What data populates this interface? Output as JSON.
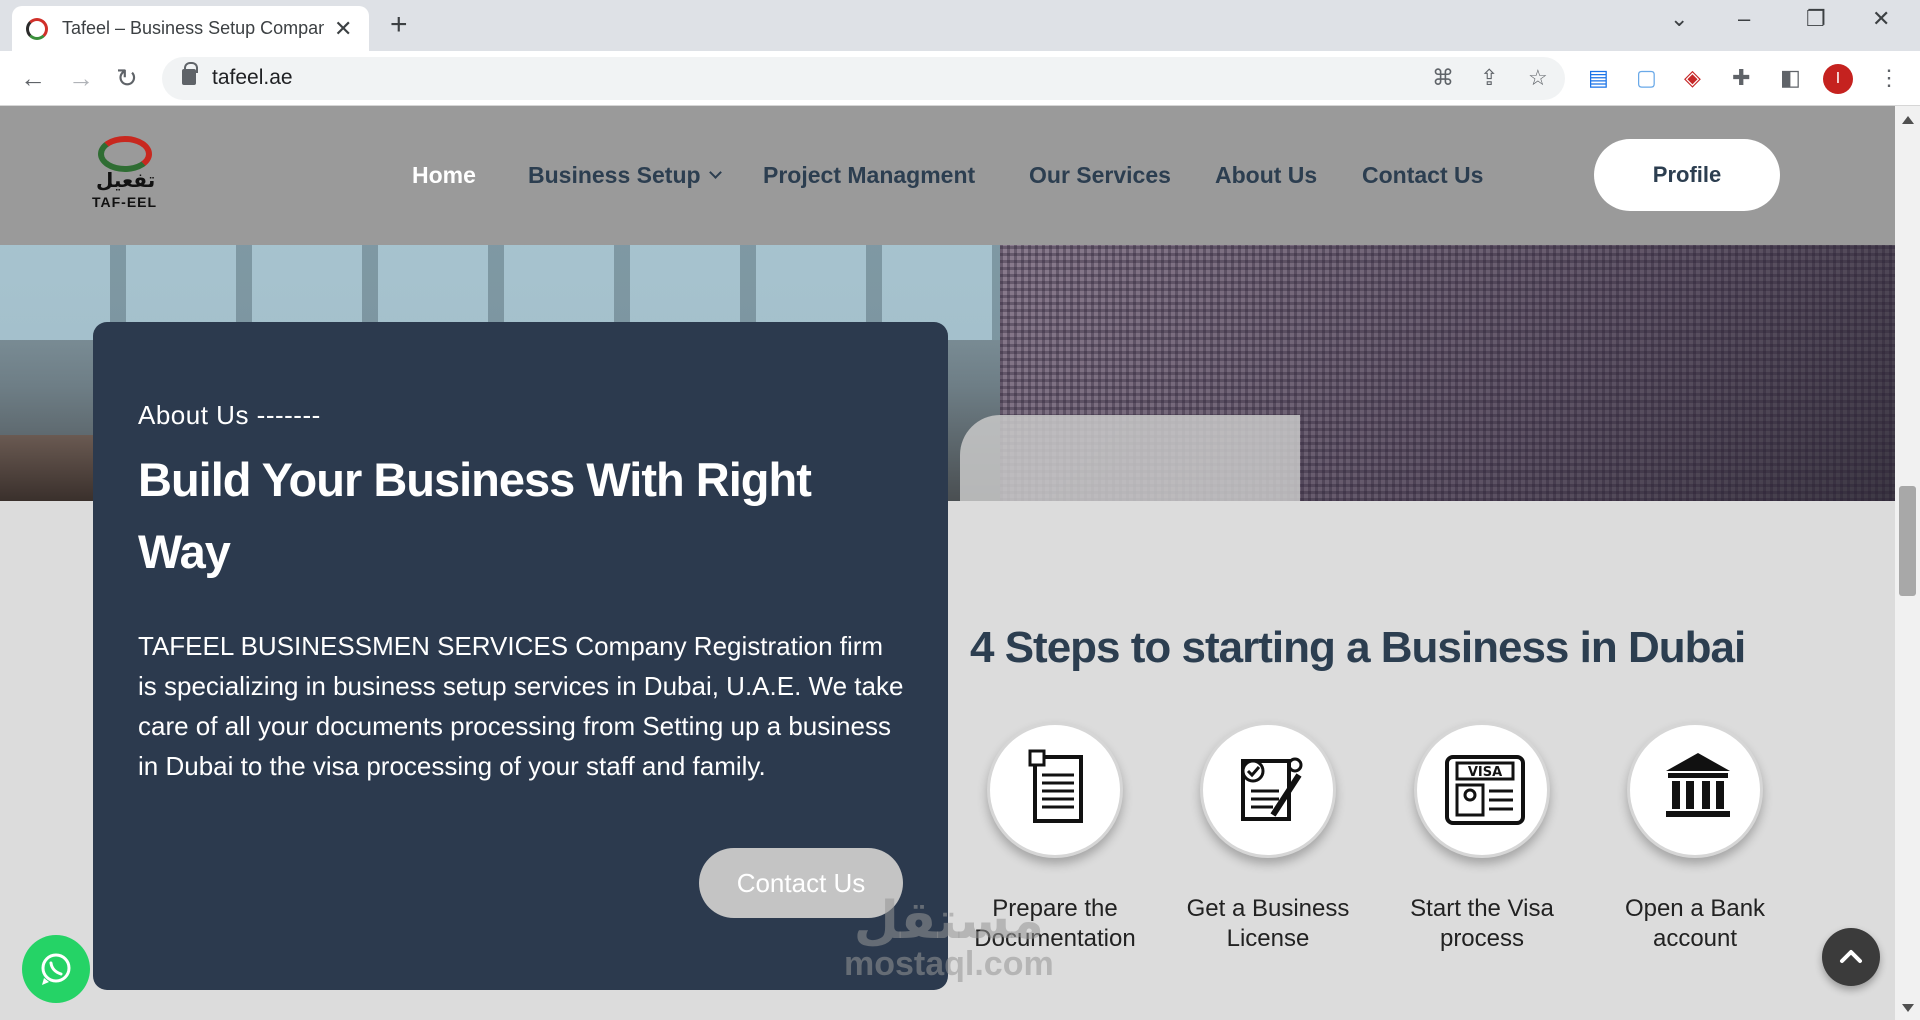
{
  "browser": {
    "tab_title": "Tafeel – Business Setup Company",
    "url": "tafeel.ae",
    "avatar_letter": "I"
  },
  "site": {
    "logo_arabic": "تفعيل",
    "logo_english": "TAF-EEL",
    "nav": [
      {
        "label": "Home"
      },
      {
        "label": "Business Setup"
      },
      {
        "label": "Project Managment"
      },
      {
        "label": "Our Services"
      },
      {
        "label": "About Us"
      },
      {
        "label": "Contact Us"
      }
    ],
    "profile_label": "Profile"
  },
  "about": {
    "kicker": "About Us -------",
    "title": "Build Your Business With Right Way",
    "body": "TAFEEL BUSINESSMEN SERVICES Company Registration firm is specializing in business setup services in Dubai, U.A.E. We take care of all your documents processing from Setting up a business in Dubai to the visa processing of your staff and family.",
    "cta_label": "Contact Us"
  },
  "steps": {
    "title": "4 Steps to starting a Business in Dubai",
    "items": [
      {
        "label": "Prepare the Documentation",
        "icon": "document-icon"
      },
      {
        "label": "Get a Business License",
        "icon": "license-icon"
      },
      {
        "label": "Start the Visa process",
        "icon": "visa-card-icon"
      },
      {
        "label": "Open a Bank account",
        "icon": "bank-icon"
      }
    ],
    "visa_text": "VISA"
  },
  "watermark": {
    "arabic": "مستقل",
    "english": "mostaql.com"
  },
  "colors": {
    "header_bg": "#9a9a9a",
    "card_bg": "#2c3a4e",
    "heading": "#2c3e50",
    "whatsapp": "#25d366"
  }
}
